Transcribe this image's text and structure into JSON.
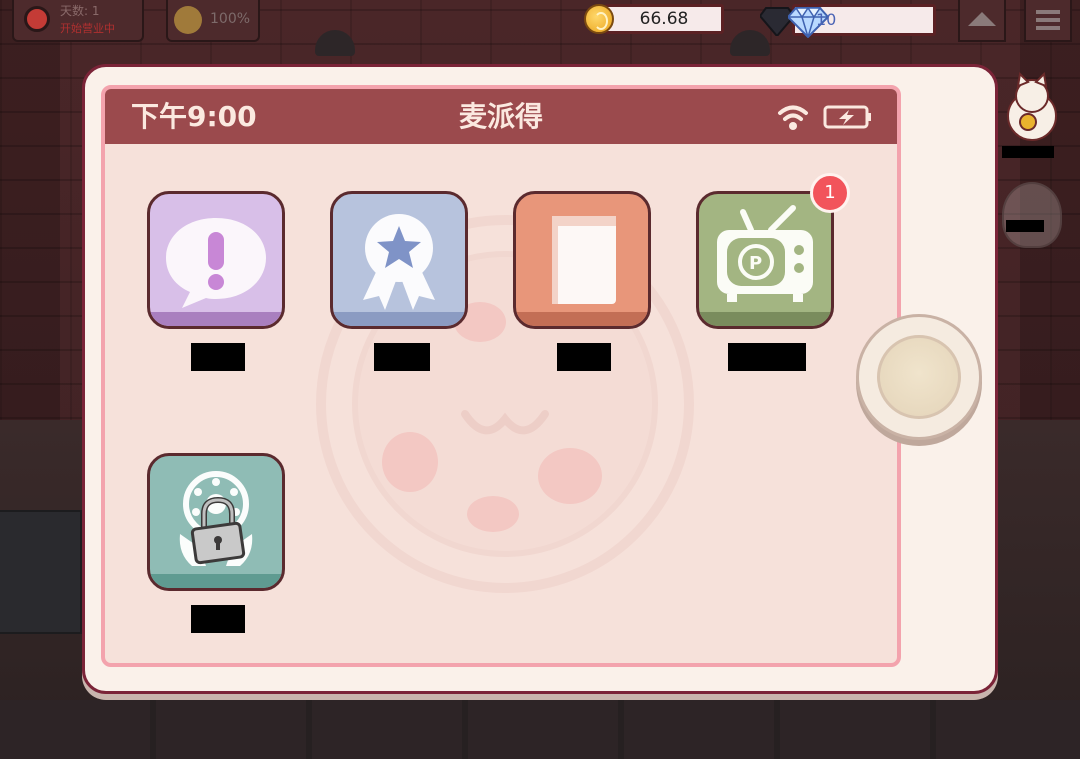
{
  "hud": {
    "day_label": "天数: 1",
    "day_sub": "开始营业中",
    "mood": "100%",
    "coins": "66.68",
    "gems": "10"
  },
  "phone": {
    "time": "下午9:00",
    "title": "麦派得",
    "colors": {
      "statusbar": "#9b4a4d",
      "screen_bg": "#f6e1da",
      "frame": "#7b2438"
    }
  },
  "apps": [
    {
      "id": "notices",
      "icon": "exclamation-bubble-icon",
      "label": "",
      "color": "#d8bfe8",
      "locked": false
    },
    {
      "id": "achievements",
      "icon": "award-ribbon-icon",
      "label": "",
      "color": "#b7c3dd",
      "locked": false
    },
    {
      "id": "recipes",
      "icon": "book-icon",
      "label": "",
      "color": "#e8967a",
      "locked": false
    },
    {
      "id": "tv",
      "icon": "tv-icon",
      "label": "",
      "color": "#a3b582",
      "locked": false,
      "badge": "1"
    },
    {
      "id": "phone-dial",
      "icon": "rotary-phone-lock-icon",
      "label": "",
      "color": "#8fbcb5",
      "locked": true
    }
  ]
}
